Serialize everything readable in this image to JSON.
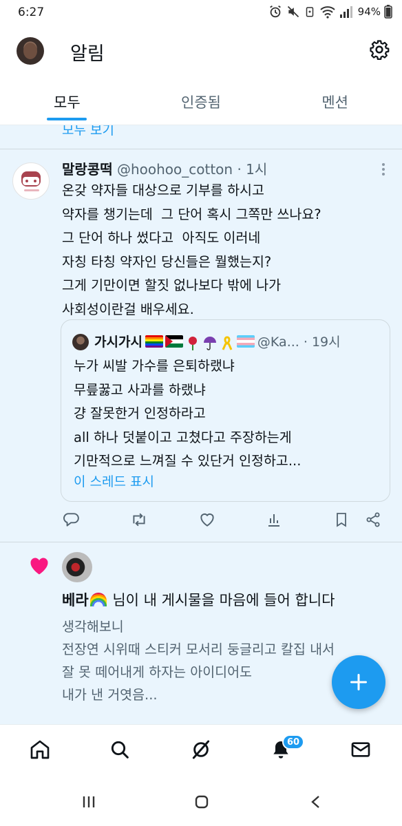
{
  "status_bar": {
    "time": "6:27",
    "battery": "94%"
  },
  "header": {
    "title": "알림"
  },
  "tabs": [
    {
      "label": "모두",
      "active": true
    },
    {
      "label": "인증됨",
      "active": false
    },
    {
      "label": "멘션",
      "active": false
    }
  ],
  "show_all": "모두 보기",
  "tweet": {
    "name": "말랑콩떡",
    "handle": "@hoohoo_cotton",
    "time": "1시",
    "body": "온갖 약자들 대상으로 기부를 하시고\n약자를 챙기는데  그 단어 혹시 그쪽만 쓰나요?\n그 단어 하나 썼다고  아직도 이러네\n자칭 타칭 약자인 당신들은 뭘했는지?\n그게 기만이면 할짓 없나보다 밖에 나가\n사회성이란걸 배우세요.",
    "quote": {
      "name": "가시가시",
      "handle": "@Ka...",
      "time": "19시",
      "body": "누가 씨발 가수를 은퇴하랬냐\n무릎꿇고 사과를 하랬냐\n걍 잘못한거 인정하라고\nall 하나 덧붙이고 고쳤다고 주장하는게\n기만적으로 느껴질 수 있단거 인정하고...",
      "show_thread": "이 스레드 표시"
    }
  },
  "like_notification": {
    "user": "베라",
    "text": "님이 내 게시물을 마음에 들어 합니다",
    "body": "생각해보니\n전장연 시위때 스티커 모서리 둥글리고 칼집 내서\n잘 못 떼어내게 하자는 아이디어도\n내가 낸 거엿음..."
  },
  "bottom_nav": {
    "notification_badge": "60"
  },
  "colors": {
    "accent": "#1d9bf0",
    "like": "#f91880",
    "highlight_bg": "#eaf5fd"
  }
}
